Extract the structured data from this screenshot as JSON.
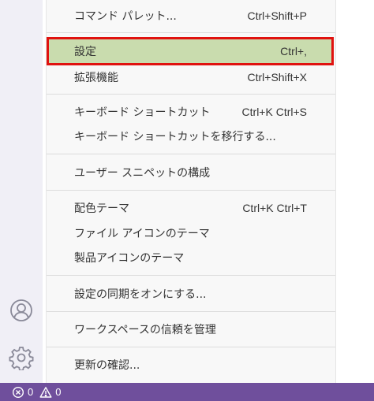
{
  "menu": {
    "items": [
      {
        "label": "コマンド パレット...",
        "shortcut": "Ctrl+Shift+P"
      },
      {
        "label": "設定",
        "shortcut": "Ctrl+,"
      },
      {
        "label": "拡張機能",
        "shortcut": "Ctrl+Shift+X"
      },
      {
        "label": "キーボード ショートカット",
        "shortcut": "Ctrl+K Ctrl+S"
      },
      {
        "label": "キーボード ショートカットを移行する...",
        "shortcut": ""
      },
      {
        "label": "ユーザー スニペットの構成",
        "shortcut": ""
      },
      {
        "label": "配色テーマ",
        "shortcut": "Ctrl+K Ctrl+T"
      },
      {
        "label": "ファイル アイコンのテーマ",
        "shortcut": ""
      },
      {
        "label": "製品アイコンのテーマ",
        "shortcut": ""
      },
      {
        "label": "設定の同期をオンにする...",
        "shortcut": ""
      },
      {
        "label": "ワークスペースの信頼を管理",
        "shortcut": ""
      },
      {
        "label": "更新の確認...",
        "shortcut": ""
      }
    ]
  },
  "activity_bar": {
    "icons": [
      "account-icon",
      "manage-gear-icon"
    ]
  },
  "statusbar": {
    "errors": "0",
    "warnings": "0",
    "color": "#6f4f9c"
  },
  "colors": {
    "highlight_bg": "#c9dcae",
    "highlight_border": "#e0120f"
  }
}
